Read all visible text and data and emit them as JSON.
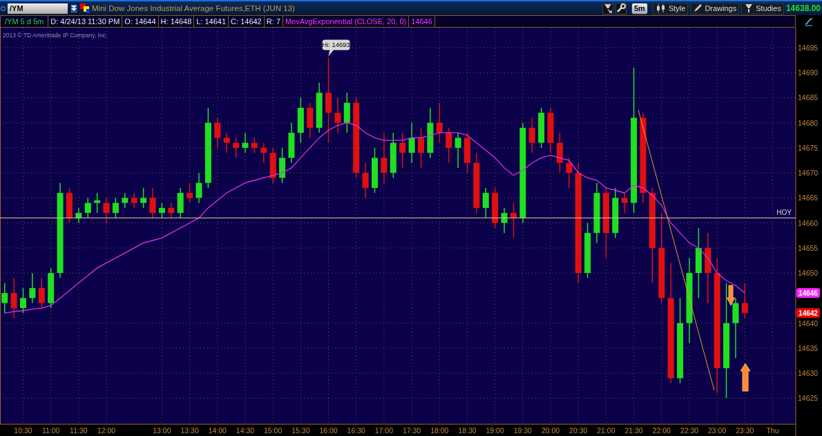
{
  "toolbar": {
    "symbol": "/YM",
    "instrument": "Mini Dow Jones Industrial Average Futures,ETH (JUN 13)",
    "buttons": [
      {
        "kind": "chip",
        "label": "5m"
      },
      {
        "kind": "style",
        "label": "Style"
      },
      {
        "kind": "drawings",
        "label": "Drawings"
      },
      {
        "kind": "studies",
        "label": "Studies"
      }
    ],
    "last_price": "14638.00"
  },
  "info_bar": {
    "cells": [
      {
        "kind": "symbol",
        "text": "/YM 5 d 5m"
      },
      {
        "kind": "plain",
        "text": "D: 4/24/13 11:30 PM"
      },
      {
        "kind": "plain",
        "text": "O: 14644"
      },
      {
        "kind": "plain",
        "text": "H: 14648"
      },
      {
        "kind": "plain",
        "text": "L: 14641"
      },
      {
        "kind": "plain",
        "text": "C: 14642"
      },
      {
        "kind": "plain",
        "text": "R: 7"
      }
    ],
    "study_value": "14646"
  },
  "chart": {
    "copyright": "2013 © TD Ameritrade IP Company, Inc.",
    "price_tags": [
      {
        "text": "14646",
        "color": "#ff22ff"
      },
      {
        "text": "14642",
        "color": "#ee0000"
      }
    ],
    "chart_data": {
      "type": "candlestick",
      "grid": true,
      "categories": [
        null,
        null,
        "10:30",
        null,
        null,
        "11:00",
        null,
        null,
        "11:30",
        null,
        null,
        "12:00",
        null,
        null,
        null,
        null,
        null,
        "13:00",
        null,
        null,
        "13:30",
        null,
        null,
        "14:00",
        null,
        null,
        "14:30",
        null,
        null,
        "15:00",
        null,
        null,
        "15:30",
        null,
        null,
        "16:00",
        null,
        null,
        "16:30",
        null,
        null,
        "17:00",
        null,
        null,
        "17:30",
        null,
        null,
        "18:00",
        null,
        null,
        "18:30",
        null,
        null,
        "19:00",
        null,
        null,
        "19:30",
        null,
        null,
        "20:00",
        null,
        null,
        "20:30",
        null,
        null,
        "21:00",
        null,
        null,
        "21:30",
        null,
        null,
        "22:00",
        null,
        null,
        "22:30",
        null,
        null,
        "23:00",
        null,
        null,
        "23:30",
        null,
        null,
        "Thu",
        null,
        null
      ],
      "ylim": [
        14619.8,
        14699
      ],
      "yticks": [
        14625,
        14630,
        14635,
        14640,
        14650,
        14655,
        14660,
        14665,
        14670,
        14675,
        14680,
        14685,
        14690,
        14695
      ],
      "ohlc": [
        [
          14644,
          14648,
          14642,
          14646
        ],
        [
          14646,
          14649,
          14641,
          14643
        ],
        [
          14643,
          14647,
          14642,
          14645
        ],
        [
          14645,
          14650,
          14644,
          14647
        ],
        [
          14647,
          14649,
          14643,
          14644
        ],
        [
          14644,
          14651,
          14643,
          14650
        ],
        [
          14650,
          14668,
          14649,
          14666
        ],
        [
          14666,
          14667,
          14660,
          14661
        ],
        [
          14661,
          14663,
          14660,
          14662
        ],
        [
          14662,
          14665,
          14661,
          14664
        ],
        [
          14664,
          14666,
          14662,
          14664.5
        ],
        [
          14664,
          14665,
          14660,
          14662
        ],
        [
          14662,
          14665,
          14661,
          14664
        ],
        [
          14664,
          14666,
          14663,
          14665
        ],
        [
          14665,
          14666,
          14663,
          14664
        ],
        [
          14664,
          14667,
          14663,
          14665
        ],
        [
          14665,
          14667,
          14661,
          14662
        ],
        [
          14662,
          14664,
          14661,
          14663
        ],
        [
          14663,
          14664,
          14661,
          14662
        ],
        [
          14662,
          14667,
          14661,
          14666
        ],
        [
          14666,
          14668,
          14664,
          14665
        ],
        [
          14665,
          14670,
          14664,
          14668
        ],
        [
          14668,
          14683,
          14667,
          14680
        ],
        [
          14680,
          14681,
          14675,
          14677
        ],
        [
          14677,
          14678,
          14674,
          14676
        ],
        [
          14676,
          14677,
          14673,
          14675
        ],
        [
          14675,
          14678,
          14674,
          14676
        ],
        [
          14676,
          14677,
          14674,
          14675
        ],
        [
          14675,
          14676,
          14672,
          14674
        ],
        [
          14674,
          14675,
          14668,
          14669
        ],
        [
          14669,
          14675,
          14668,
          14673
        ],
        [
          14673,
          14680,
          14672,
          14678
        ],
        [
          14678,
          14685,
          14676,
          14683
        ],
        [
          14683,
          14684,
          14677,
          14679
        ],
        [
          14679,
          14688,
          14678,
          14686
        ],
        [
          14686,
          14693,
          14676,
          14682
        ],
        [
          14682,
          14685,
          14678,
          14680
        ],
        [
          14680,
          14686,
          14678,
          14684
        ],
        [
          14684,
          14685,
          14669,
          14670
        ],
        [
          14670,
          14672,
          14665,
          14667
        ],
        [
          14667,
          14675,
          14666,
          14673
        ],
        [
          14673,
          14678,
          14668,
          14670
        ],
        [
          14670,
          14678,
          14669,
          14676
        ],
        [
          14676,
          14678,
          14671,
          14674
        ],
        [
          14674,
          14680,
          14672,
          14677
        ],
        [
          14677,
          14679,
          14671,
          14674
        ],
        [
          14674,
          14683,
          14673,
          14680
        ],
        [
          14680,
          14684,
          14676,
          14678
        ],
        [
          14678,
          14679,
          14672,
          14675
        ],
        [
          14675,
          14678,
          14671,
          14677
        ],
        [
          14677,
          14678,
          14670,
          14672
        ],
        [
          14672,
          14674,
          14662,
          14663
        ],
        [
          14663,
          14667,
          14661,
          14666
        ],
        [
          14666,
          14667,
          14659,
          14660
        ],
        [
          14660,
          14663,
          14658,
          14662
        ],
        [
          14662,
          14664,
          14657,
          14661
        ],
        [
          14661,
          14680,
          14660,
          14679
        ],
        [
          14679,
          14681,
          14674,
          14676
        ],
        [
          14676,
          14683,
          14675,
          14682
        ],
        [
          14682,
          14683,
          14674,
          14676
        ],
        [
          14676,
          14678,
          14670,
          14672
        ],
        [
          14672,
          14673,
          14667,
          14670
        ],
        [
          14670,
          14672,
          14648,
          14650
        ],
        [
          14650,
          14660,
          14649,
          14658
        ],
        [
          14658,
          14668,
          14656,
          14666
        ],
        [
          14666,
          14667,
          14653,
          14658
        ],
        [
          14658,
          14667,
          14657,
          14665
        ],
        [
          14665,
          14666,
          14662,
          14664
        ],
        [
          14664,
          14691,
          14662,
          14681
        ],
        [
          14681,
          14682,
          14664,
          14666
        ],
        [
          14666,
          14667,
          14648,
          14655
        ],
        [
          14655,
          14662,
          14644,
          14645
        ],
        [
          14645,
          14652,
          14628,
          14629
        ],
        [
          14629,
          14645,
          14628,
          14640
        ],
        [
          14640,
          14653,
          14636,
          14650
        ],
        [
          14650,
          14659,
          14645,
          14655
        ],
        [
          14655,
          14658,
          14644,
          14650
        ],
        [
          14650,
          14653,
          14626,
          14631
        ],
        [
          14631,
          14648,
          14625,
          14640
        ],
        [
          14640,
          14645,
          14633,
          14644
        ],
        [
          14644,
          14648,
          14641,
          14642
        ],
        null,
        null,
        null,
        null,
        null
      ],
      "series": [
        {
          "name": "MovAvgExponential (CLOSE, 20, 0)",
          "type": "line",
          "color": "#e030e0",
          "values": [
            14642,
            14642.3,
            14642.5,
            14642.8,
            14643,
            14643.5,
            14645,
            14646.5,
            14648,
            14649.5,
            14651,
            14652,
            14653,
            14654,
            14655,
            14656,
            14656.5,
            14657,
            14658,
            14659,
            14660,
            14661,
            14663,
            14664.5,
            14666,
            14667,
            14668,
            14668.5,
            14669,
            14669.5,
            14670,
            14671,
            14673,
            14675,
            14677,
            14678.5,
            14679.5,
            14680,
            14679.5,
            14678,
            14677,
            14676.5,
            14676.5,
            14676.5,
            14677,
            14677,
            14677.5,
            14678,
            14678,
            14678,
            14677.5,
            14676,
            14674.5,
            14673,
            14671,
            14669.5,
            14670.5,
            14672,
            14673,
            14673.5,
            14673,
            14672.5,
            14670,
            14669,
            14668.5,
            14667,
            14666.5,
            14666,
            14667.5,
            14667,
            14665.5,
            14663.5,
            14660,
            14658,
            14656,
            14655,
            14653,
            14650,
            14648.5,
            14647.5,
            14646,
            null,
            null,
            null,
            null,
            null
          ]
        }
      ],
      "ref_lines": [
        {
          "axis": "y",
          "value": 14661,
          "label": "HOY",
          "color": "#f0c890"
        }
      ],
      "annotations": [
        {
          "text": "Hi: 14693"
        }
      ]
    }
  }
}
